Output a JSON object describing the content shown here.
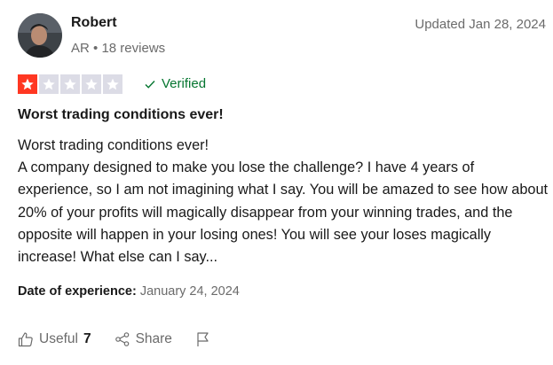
{
  "author": {
    "name": "Robert",
    "country": "AR",
    "separator": "•",
    "reviews": "18 reviews"
  },
  "updated": "Updated Jan 28, 2024",
  "rating": {
    "value": 1,
    "max": 5
  },
  "verified_label": "Verified",
  "review": {
    "title": "Worst trading conditions ever!",
    "body_line1": "Worst trading conditions ever!",
    "body_line2": "A company designed to make you lose the challenge? I have 4 years of experience, so I am not imagining what I say. You will be amazed to see how about 20% of your profits will magically disappear from your winning trades, and the opposite will happen in your losing ones! You will see your loses magically increase! What else can I say..."
  },
  "experience": {
    "label": "Date of experience:",
    "date": "January 24, 2024"
  },
  "actions": {
    "useful_label": "Useful",
    "useful_count": "7",
    "share_label": "Share"
  },
  "colors": {
    "star_on": "#ff3722",
    "star_off": "#dcdce6",
    "verified": "#04752f"
  },
  "icons": [
    "avatar-photo",
    "star-icon",
    "checkmark-icon",
    "thumbs-up-icon",
    "share-icon",
    "flag-icon"
  ]
}
